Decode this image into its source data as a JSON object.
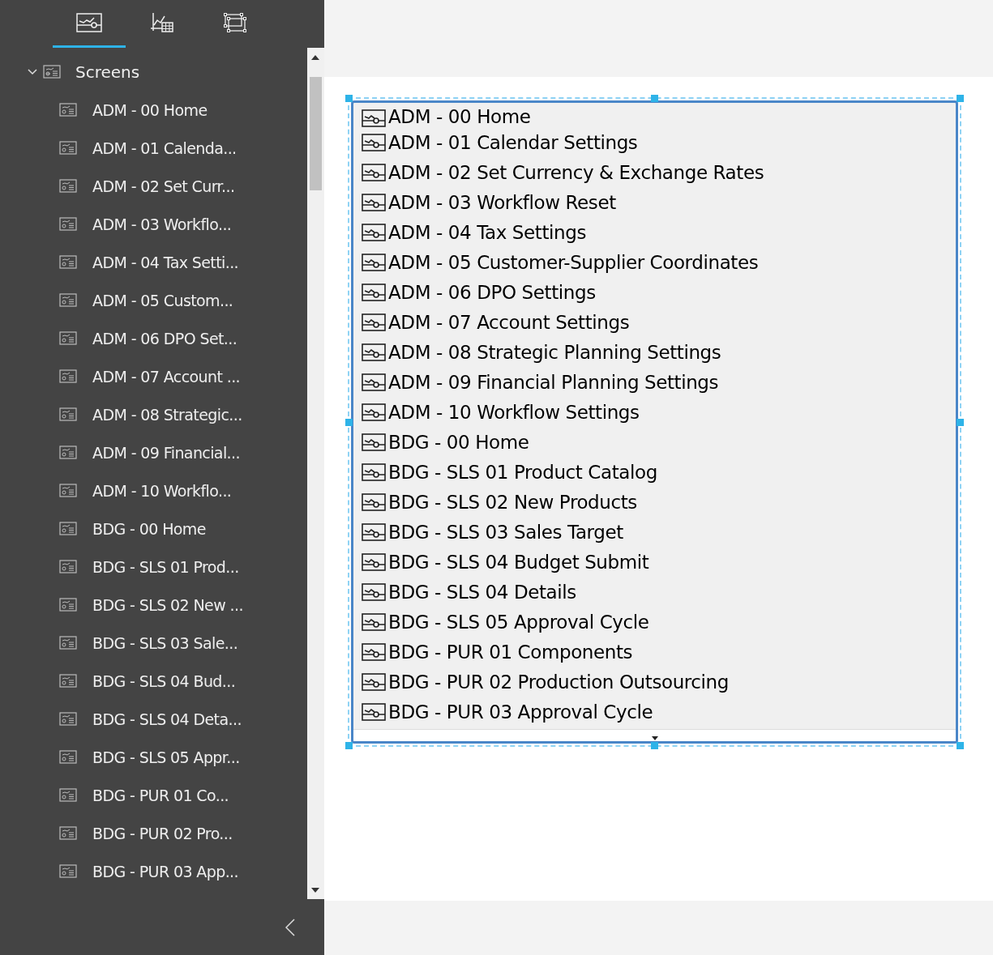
{
  "sidebar": {
    "tabs": [
      {
        "kind": "screens",
        "selected": true
      },
      {
        "kind": "data",
        "selected": false
      },
      {
        "kind": "layout",
        "selected": false
      }
    ],
    "tree": {
      "label": "Screens",
      "expanded": true,
      "children": [
        {
          "label": "ADM - 00 Home"
        },
        {
          "label": "ADM - 01 Calenda..."
        },
        {
          "label": "ADM - 02 Set Curr..."
        },
        {
          "label": "ADM - 03 Workflo..."
        },
        {
          "label": "ADM - 04 Tax Setti..."
        },
        {
          "label": "ADM - 05 Custom..."
        },
        {
          "label": "ADM - 06 DPO Set..."
        },
        {
          "label": "ADM - 07 Account ..."
        },
        {
          "label": "ADM - 08 Strategic..."
        },
        {
          "label": "ADM - 09 Financial..."
        },
        {
          "label": "ADM - 10 Workflo..."
        },
        {
          "label": "BDG - 00 Home"
        },
        {
          "label": "BDG - SLS 01 Prod..."
        },
        {
          "label": "BDG - SLS 02 New ..."
        },
        {
          "label": "BDG - SLS 03 Sale..."
        },
        {
          "label": "BDG - SLS 04 Bud..."
        },
        {
          "label": "BDG - SLS 04 Deta..."
        },
        {
          "label": "BDG - SLS 05 Appr..."
        },
        {
          "label": "BDG - PUR 01 Co..."
        },
        {
          "label": "BDG - PUR 02 Pro..."
        },
        {
          "label": "BDG - PUR 03 App..."
        }
      ]
    }
  },
  "canvas": {
    "listbox": {
      "items": [
        "ADM - 00 Home",
        "ADM - 01 Calendar Settings",
        "ADM - 02 Set Currency & Exchange Rates",
        "ADM - 03 Workflow Reset",
        "ADM - 04 Tax Settings",
        "ADM - 05 Customer-Supplier Coordinates",
        "ADM - 06 DPO Settings",
        "ADM - 07 Account Settings",
        "ADM - 08 Strategic Planning Settings",
        "ADM - 09 Financial Planning Settings",
        "ADM - 10 Workflow Settings",
        "BDG - 00 Home",
        "BDG - SLS 01 Product Catalog",
        "BDG - SLS 02 New Products",
        "BDG - SLS 03 Sales Target",
        "BDG - SLS 04 Budget Submit",
        "BDG - SLS 04 Details",
        "BDG - SLS 05 Approval Cycle",
        "BDG - PUR 01 Components",
        "BDG - PUR 02 Production Outsourcing",
        "BDG - PUR 03 Approval Cycle"
      ],
      "selected_on_canvas": true
    }
  }
}
